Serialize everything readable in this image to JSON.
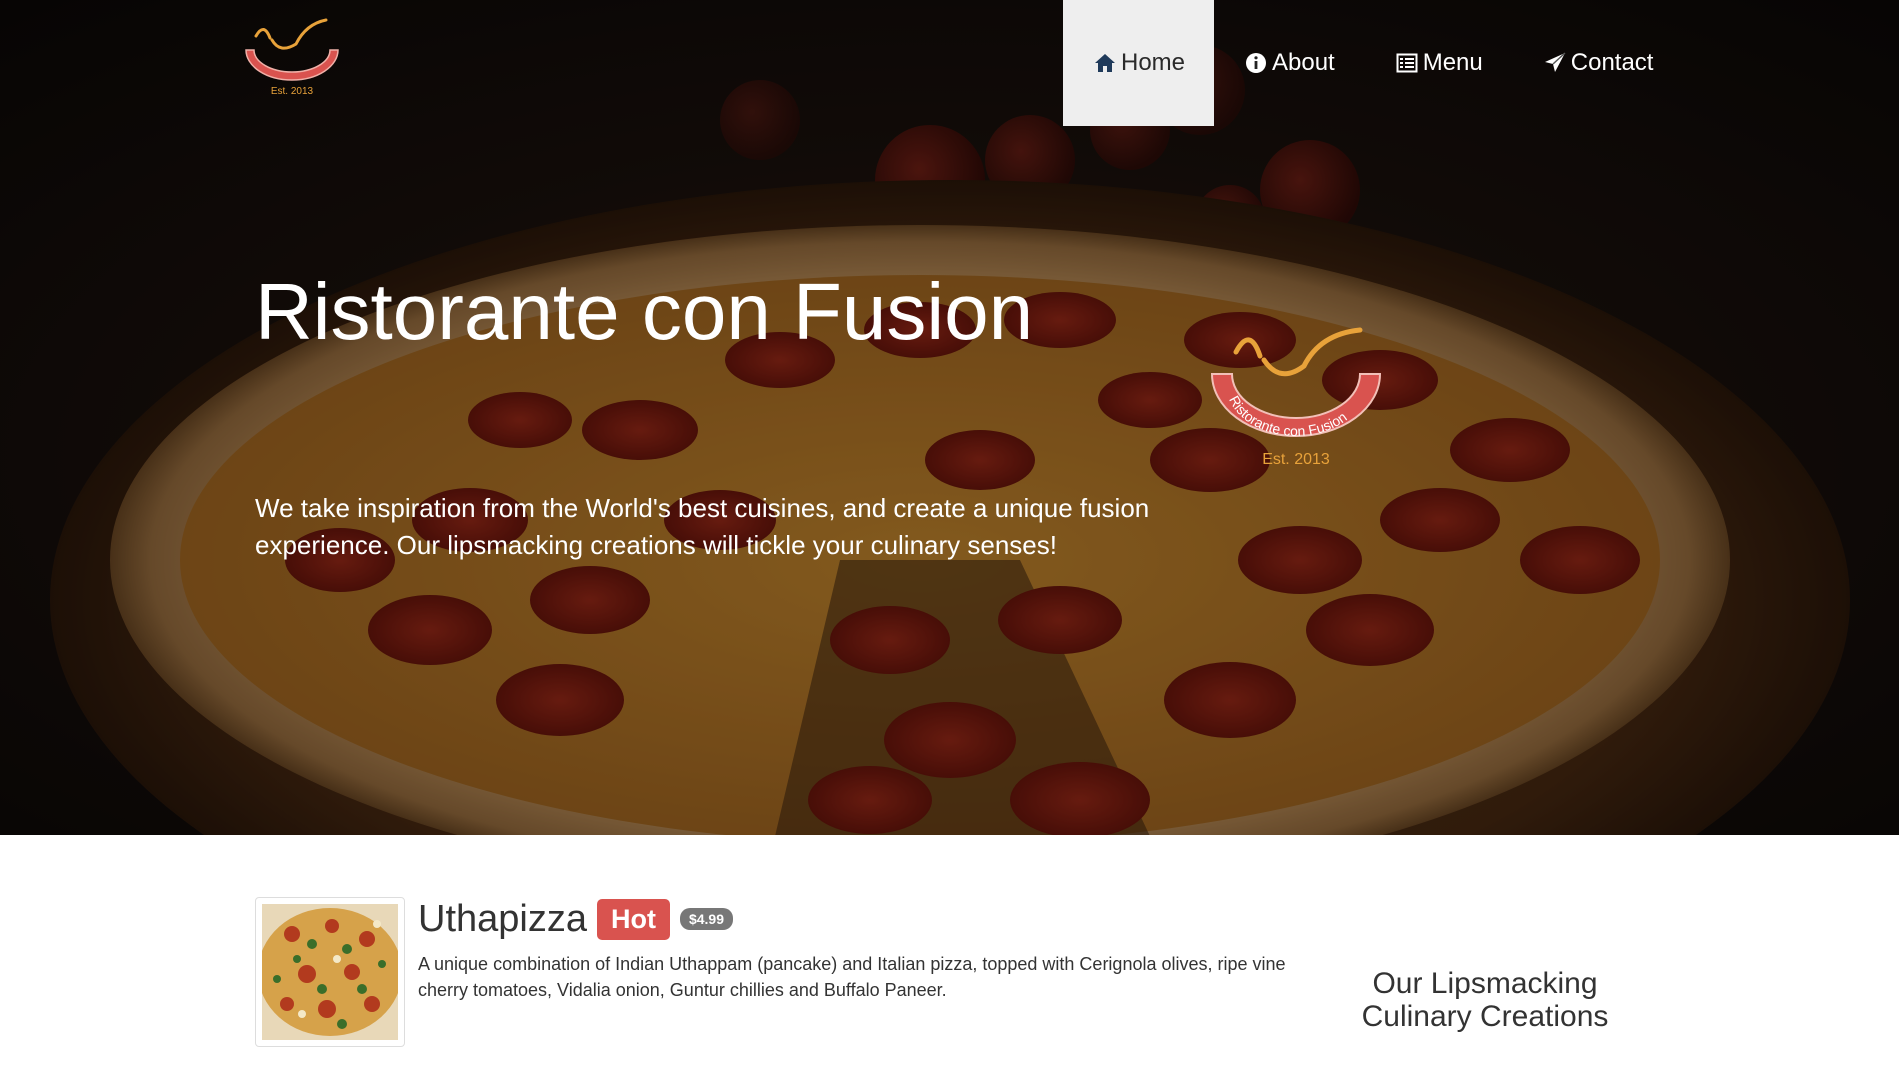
{
  "brand": {
    "logo_text": "Ristorante con Fusion",
    "logo_est": "Est. 2013"
  },
  "nav": {
    "items": [
      {
        "label": "Home",
        "icon": "home-icon",
        "active": true
      },
      {
        "label": "About",
        "icon": "info-circle-icon",
        "active": false
      },
      {
        "label": "Menu",
        "icon": "list-alt-icon",
        "active": false
      },
      {
        "label": "Contact",
        "icon": "send-icon",
        "active": false
      }
    ]
  },
  "hero": {
    "title": "Ristorante con Fusion",
    "text": "We take inspiration from the World's best cuisines, and create a unique fusion experience. Our lipsmacking creations will tickle your culinary senses!",
    "logo_text": "Ristorante con Fusion",
    "logo_est": "Est. 2013"
  },
  "featured": {
    "name": "Uthapizza",
    "badge": "Hot",
    "price": "$4.99",
    "description": "A unique combination of Indian Uthappam (pancake) and Italian pizza, topped with Cerignola olives, ripe vine cherry tomatoes, Vidalia onion, Guntur chillies and Buffalo Paneer."
  },
  "side": {
    "heading": "Our Lipsmacking Culinary Creations"
  },
  "colors": {
    "nav_active_bg": "#eeeeee",
    "badge_hot": "#d9534f",
    "badge_price": "#777777",
    "logo_ring": "#d9534f",
    "logo_gold": "#e8a23a"
  }
}
